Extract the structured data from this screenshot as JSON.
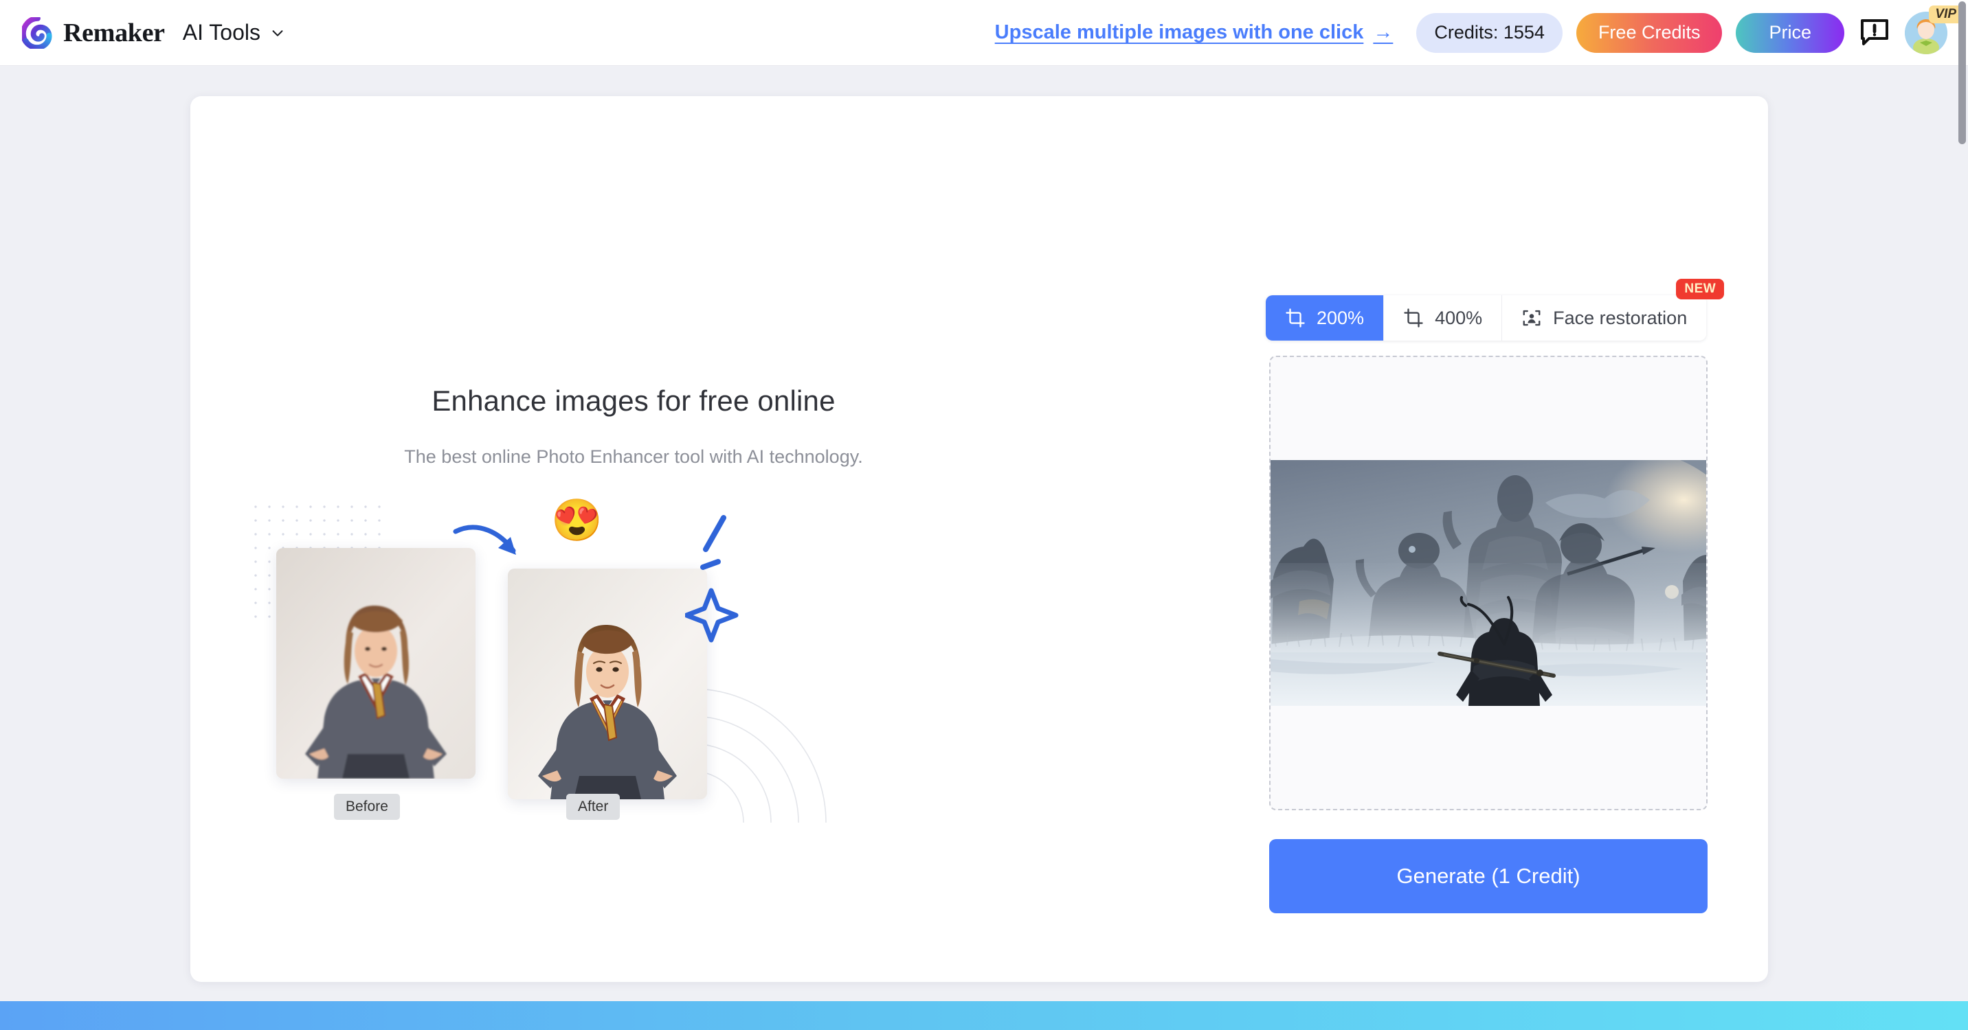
{
  "header": {
    "brand_name": "Remaker",
    "nav_label": "AI Tools",
    "nav_chevron_icon": "chevron-down-icon",
    "logo_icon": "remaker-swirl-logo",
    "promo_link": "Upscale multiple images with one click",
    "promo_arrow": "→",
    "credits_label": "Credits: 1554",
    "free_credits_label": "Free Credits",
    "price_label": "Price",
    "feedback_icon": "feedback-exclamation-icon",
    "avatar_icon": "user-avatar",
    "vip_badge": "VIP"
  },
  "promo": {
    "title": "Enhance images for free online",
    "subtitle": "The best online Photo Enhancer tool with AI technology.",
    "before_label": "Before",
    "after_label": "After",
    "emoji": "😍",
    "arrow_icon": "curved-arrow-icon",
    "sparkle_icon": "sparkle-icon",
    "dots_icon": "dot-grid-decoration",
    "arcs_icon": "concentric-arcs-decoration"
  },
  "tool": {
    "tabs": [
      {
        "label": "200%",
        "icon": "crop-icon",
        "active": true,
        "badge": ""
      },
      {
        "label": "400%",
        "icon": "crop-icon",
        "active": false,
        "badge": ""
      },
      {
        "label": "Face restoration",
        "icon": "face-scan-icon",
        "active": false,
        "badge": "NEW"
      }
    ],
    "badge_new": "NEW",
    "dropzone_icon": "image-upload-dropzone",
    "uploaded_image_alt": "game screenshot with armored warriors in snow",
    "generate_label": "Generate (1 Credit)"
  },
  "colors": {
    "accent_blue": "#4a7dfc",
    "credits_pill_bg": "#dfe6fb",
    "free_credits_gradient_start": "#f6ab3d",
    "free_credits_gradient_end": "#ef3f6e",
    "price_gradient_start": "#4ec5c0",
    "price_gradient_end": "#8b2bf0",
    "new_badge_red": "#f03a2f",
    "vip_badge_yellow": "#fbdd92",
    "page_bg": "#eff0f5",
    "bottom_strip_start": "#5ba3f5",
    "bottom_strip_end": "#63e0f5"
  }
}
